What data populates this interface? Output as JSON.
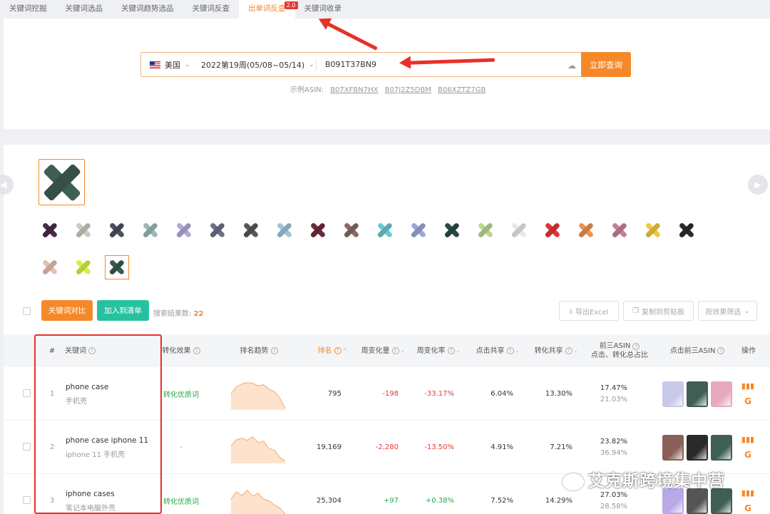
{
  "tabs": [
    {
      "label": "关键词挖掘"
    },
    {
      "label": "关键词选品"
    },
    {
      "label": "关键词趋势选品"
    },
    {
      "label": "关键词反查"
    },
    {
      "label": "出单词反查",
      "badge": "2.0",
      "active": true
    },
    {
      "label": "关键词收录"
    }
  ],
  "search": {
    "country": "美国",
    "week": "2022第19周(05/08~05/14)",
    "asin_value": "B091T37BN9",
    "query_button": "立即查询",
    "examples_label": "示例ASIN:",
    "examples": [
      "B07XFBN7HX",
      "B07J2Z5DBM",
      "B06XZTZ7GB"
    ]
  },
  "variants": {
    "colors": [
      "#4a2a4a",
      "#c8cbbf",
      "#4a5060",
      "#9ab8b8",
      "#b0a8d8",
      "#6a7088",
      "#555859",
      "#9fc4d8",
      "#6e2a3a",
      "#8a6a60",
      "#6ac8d0",
      "#9aa8d8",
      "#2a4a48",
      "#b8d890",
      "#e8e8e8",
      "#e0353a",
      "#f09050",
      "#c8809a",
      "#f0c840",
      "#2a2a2a",
      "#e8c0b0",
      "#d8f040",
      "#3a5a50"
    ],
    "selected_index": 22,
    "main_color": "#3f5e55"
  },
  "toolbar": {
    "compare_button": "关键词对比",
    "add_list_button": "加入到清单",
    "count_label": "搜索结果数:",
    "count_value": "22",
    "export_button": "导出Excel",
    "copy_button": "复制到剪贴板",
    "filter_button": "按效果筛选"
  },
  "table": {
    "headers": {
      "idx": "#",
      "keyword": "关键词",
      "effect": "转化效果",
      "trend": "排名趋势",
      "rank": "排名",
      "week_change": "周变化量",
      "week_rate": "周变化率",
      "click_share": "点击共享",
      "conv_share": "转化共享",
      "top3_line1": "前三ASIN",
      "top3_line2": "点击、转化总占比",
      "top3_asin": "点击前三ASIN",
      "ops": "操作"
    },
    "rows": [
      {
        "idx": "1",
        "keyword": "phone case",
        "keyword_cn": "手机壳",
        "effect": "转化优质词",
        "rank": "795",
        "week_change": "-198",
        "week_rate": "-33.17%",
        "click_share": "6.04%",
        "conv_share": "13.30%",
        "top3_click": "17.47%",
        "top3_conv": "21.03%",
        "trend": [
          0.55,
          0.78,
          0.88,
          0.92,
          0.9,
          0.82,
          0.85,
          0.7,
          0.62,
          0.4,
          0.05
        ],
        "asin_colors": [
          "#c8c8e8",
          "#3f5e55",
          "#e8a8c0"
        ]
      },
      {
        "idx": "2",
        "keyword": "phone case iphone 11",
        "keyword_cn": "iphone 11 手机壳",
        "effect": "-",
        "rank": "19,169",
        "week_change": "-2,280",
        "week_rate": "-13.50%",
        "click_share": "4.91%",
        "conv_share": "7.21%",
        "top3_click": "23.82%",
        "top3_conv": "36.94%",
        "trend": [
          0.6,
          0.8,
          0.85,
          0.78,
          0.9,
          0.7,
          0.75,
          0.5,
          0.45,
          0.2,
          0.08
        ],
        "asin_colors": [
          "#8a6058",
          "#2a2a2a",
          "#3f5e55"
        ]
      },
      {
        "idx": "3",
        "keyword": "iphone cases",
        "keyword_cn": "笔记本电脑外壳",
        "effect": "转化优质词",
        "rank": "25,304",
        "week_change": "+97",
        "week_rate": "+0.38%",
        "click_share": "7.52%",
        "conv_share": "14.29%",
        "top3_click": "27.03%",
        "top3_conv": "28.58%",
        "trend": [
          0.6,
          0.85,
          0.72,
          0.9,
          0.7,
          0.8,
          0.6,
          0.55,
          0.4,
          0.3,
          0.1
        ],
        "asin_colors": [
          "#b8a8e8",
          "#555555",
          "#3f5e55"
        ]
      }
    ]
  },
  "watermark": "艾克斯跨境集中营"
}
